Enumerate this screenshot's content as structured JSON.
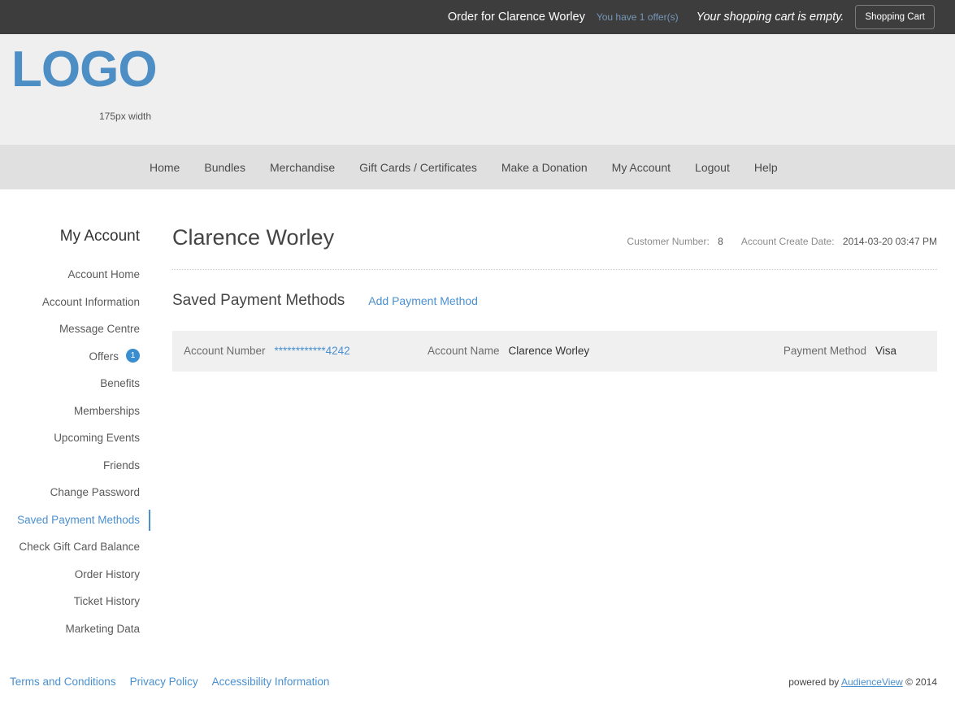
{
  "topbar": {
    "order_prefix": "Order for ",
    "order_customer": "Clarence Worley",
    "offers_link": "You have 1 offer(s)",
    "cart_message": "Your shopping cart is empty.",
    "cart_button": "Shopping Cart",
    "background_color": "#3d3d3d",
    "link_color": "#7697b8"
  },
  "branding": {
    "logo_text": "LOGO",
    "logo_caption": "175px width",
    "logo_color": "#4d8fc4"
  },
  "nav": {
    "items": [
      {
        "label": "Home"
      },
      {
        "label": "Bundles"
      },
      {
        "label": "Merchandise"
      },
      {
        "label": "Gift Cards / Certificates"
      },
      {
        "label": "Make a Donation"
      },
      {
        "label": "My Account"
      },
      {
        "label": "Logout"
      },
      {
        "label": "Help"
      }
    ]
  },
  "sidebar": {
    "title": "My Account",
    "active_item": "Saved Payment Methods",
    "accent_color": "#4a90d0",
    "items": [
      {
        "label": "Account Home",
        "badge": null,
        "active": false
      },
      {
        "label": "Account Information",
        "badge": null,
        "active": false
      },
      {
        "label": "Message Centre",
        "badge": null,
        "active": false
      },
      {
        "label": "Offers",
        "badge": "1",
        "active": false
      },
      {
        "label": "Benefits",
        "badge": null,
        "active": false
      },
      {
        "label": "Memberships",
        "badge": null,
        "active": false
      },
      {
        "label": "Upcoming Events",
        "badge": null,
        "active": false
      },
      {
        "label": "Friends",
        "badge": null,
        "active": false
      },
      {
        "label": "Change Password",
        "badge": null,
        "active": false
      },
      {
        "label": "Saved Payment Methods",
        "badge": null,
        "active": true
      },
      {
        "label": "Check Gift Card Balance",
        "badge": null,
        "active": false
      },
      {
        "label": "Order History",
        "badge": null,
        "active": false
      },
      {
        "label": "Ticket History",
        "badge": null,
        "active": false
      },
      {
        "label": "Marketing Data",
        "badge": null,
        "active": false
      }
    ]
  },
  "main": {
    "account_name": "Clarence Worley",
    "meta": {
      "customer_number_label": "Customer Number:",
      "customer_number_value": "8",
      "create_date_label": "Account Create Date:",
      "create_date_value": "2014-03-20 03:47 PM"
    },
    "section": {
      "title": "Saved Payment Methods",
      "add_link": "Add Payment Method"
    },
    "payment_rows": [
      {
        "account_number_label": "Account Number",
        "account_number_value": "************4242",
        "account_name_label": "Account Name",
        "account_name_value": "Clarence Worley",
        "payment_method_label": "Payment Method",
        "payment_method_value": "Visa"
      }
    ]
  },
  "footer": {
    "links": [
      {
        "label": "Terms and Conditions"
      },
      {
        "label": "Privacy Policy"
      },
      {
        "label": "Accessibility Information"
      }
    ],
    "powered_by": "powered by ",
    "brand": "AudienceView",
    "copyright": " © 2014"
  }
}
